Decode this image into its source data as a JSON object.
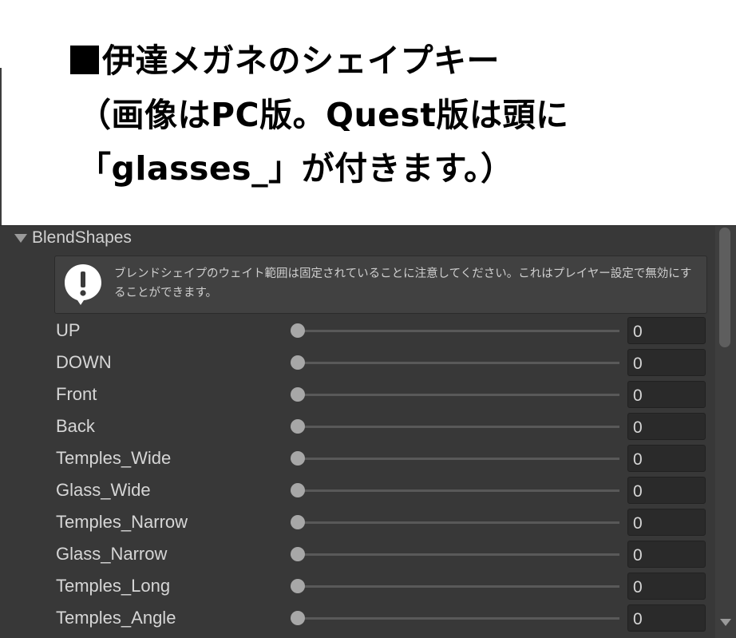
{
  "caption": {
    "line1": "伊達メガネのシェイプキー",
    "line2": "（画像はPC版。Quest版は頭に",
    "line3": "「glasses_」が付きます。）"
  },
  "panel": {
    "foldout_label": "BlendShapes",
    "help_text": "ブレンドシェイプのウェイト範囲は固定されていることに注意してください。これはプレイヤー設定で無効にすることができます。",
    "help_icon": "warning-exclamation-icon"
  },
  "blendshapes": [
    {
      "label": "UP",
      "value": "0"
    },
    {
      "label": "DOWN",
      "value": "0"
    },
    {
      "label": "Front",
      "value": "0"
    },
    {
      "label": "Back",
      "value": "0"
    },
    {
      "label": "Temples_Wide",
      "value": "0"
    },
    {
      "label": "Glass_Wide",
      "value": "0"
    },
    {
      "label": "Temples_Narrow",
      "value": "0"
    },
    {
      "label": "Glass_Narrow",
      "value": "0"
    },
    {
      "label": "Temples_Long",
      "value": "0"
    },
    {
      "label": "Temples_Angle",
      "value": "0"
    }
  ],
  "colors": {
    "panel_bg": "#383838",
    "field_bg": "#2a2a2a",
    "thumb": "#a7a7a7",
    "text": "#d6d6d6"
  }
}
